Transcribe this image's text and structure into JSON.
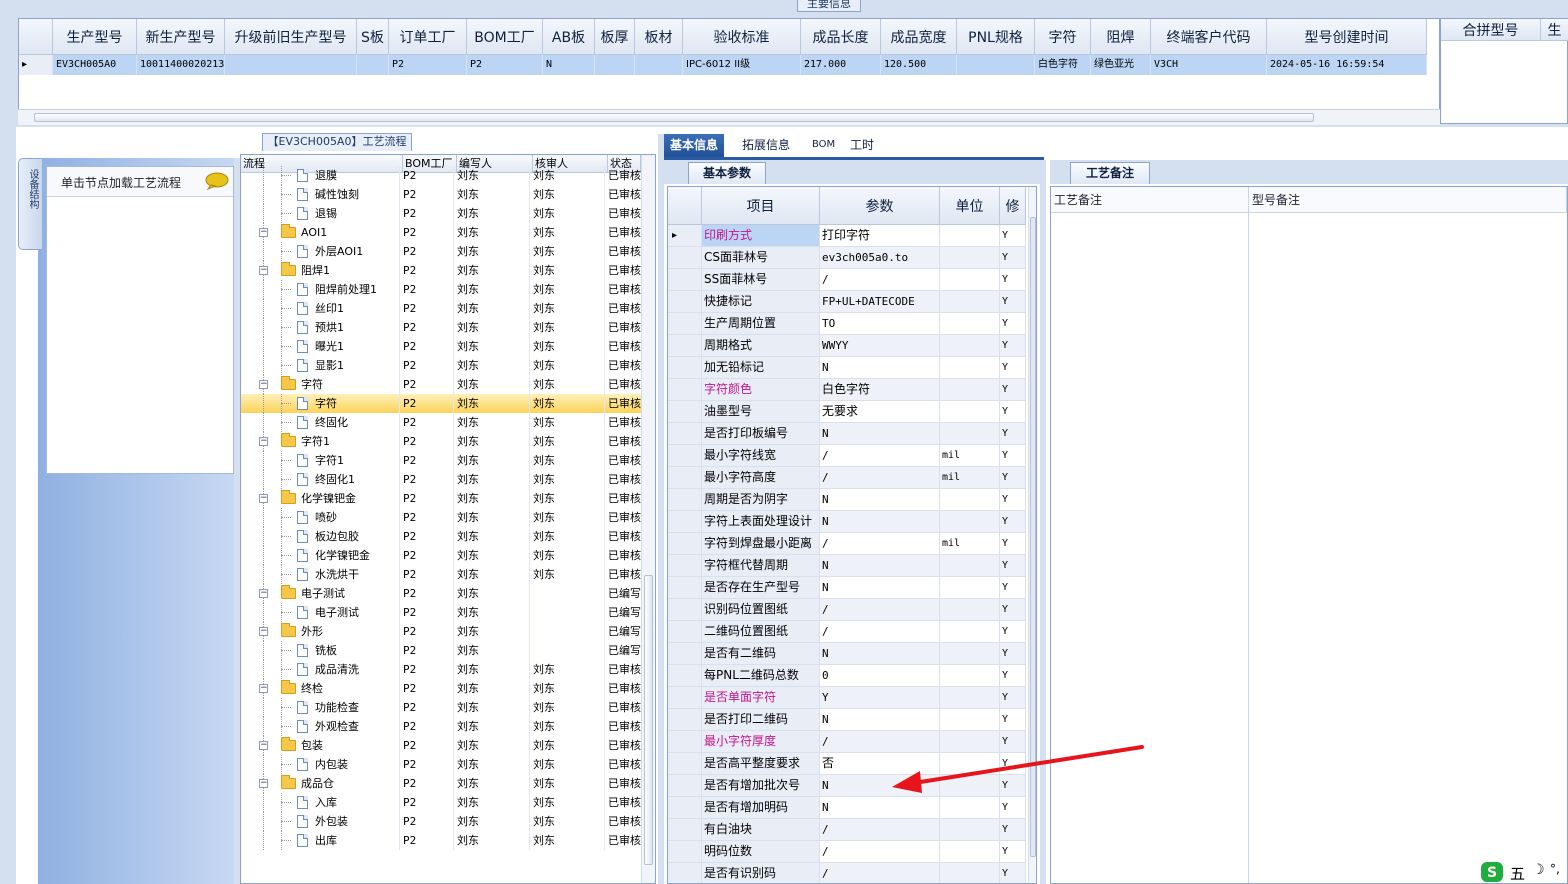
{
  "top": {
    "caption": "主要信息",
    "columns": [
      {
        "label": "生产型号",
        "w": 84
      },
      {
        "label": "新生产型号",
        "w": 88
      },
      {
        "label": "升级前旧生产型号",
        "w": 132
      },
      {
        "label": "S板",
        "w": 32
      },
      {
        "label": "订单工厂",
        "w": 78
      },
      {
        "label": "BOM工厂",
        "w": 76
      },
      {
        "label": "AB板",
        "w": 52
      },
      {
        "label": "板厚",
        "w": 40
      },
      {
        "label": "板材",
        "w": 48
      },
      {
        "label": "验收标准",
        "w": 118
      },
      {
        "label": "成品长度",
        "w": 80
      },
      {
        "label": "成品宽度",
        "w": 76
      },
      {
        "label": "PNL规格",
        "w": 78
      },
      {
        "label": "字符",
        "w": 56
      },
      {
        "label": "阻焊",
        "w": 60
      },
      {
        "label": "终端客户代码",
        "w": 116
      },
      {
        "label": "型号创建时间",
        "w": 160
      }
    ],
    "row": [
      "EV3CH005A0",
      "10011400020213",
      "",
      "",
      "P2",
      "P2",
      "N",
      "",
      "",
      "IPC-6012 II级",
      "217.000",
      "120.500",
      "",
      "白色字符",
      "绿色亚光",
      "V3CH",
      "2024-05-16 16:59:54"
    ],
    "merge_header": "合拼型号",
    "merge_header2": "生"
  },
  "side": {
    "tab_label": "设备结构",
    "hint": "单击节点加载工艺流程"
  },
  "tree": {
    "caption": "【EV3CH005A0】工艺流程",
    "headers": [
      "流程",
      "BOM工厂",
      "编写人",
      "核审人",
      "状态"
    ],
    "rows": [
      {
        "label": "退膜",
        "level": 2,
        "kind": "doc",
        "bom": "P2",
        "writer": "刘东",
        "reviewer": "刘东",
        "status": "已审核",
        "partial": true
      },
      {
        "label": "碱性蚀刻",
        "level": 2,
        "kind": "doc",
        "bom": "P2",
        "writer": "刘东",
        "reviewer": "刘东",
        "status": "已审核"
      },
      {
        "label": "退锡",
        "level": 2,
        "kind": "doc",
        "bom": "P2",
        "writer": "刘东",
        "reviewer": "刘东",
        "status": "已审核"
      },
      {
        "label": "AOI1",
        "level": 1,
        "kind": "folder",
        "bom": "P2",
        "writer": "刘东",
        "reviewer": "刘东",
        "status": "已审核"
      },
      {
        "label": "外层AOI1",
        "level": 2,
        "kind": "doc",
        "bom": "P2",
        "writer": "刘东",
        "reviewer": "刘东",
        "status": "已审核"
      },
      {
        "label": "阻焊1",
        "level": 1,
        "kind": "folder",
        "bom": "P2",
        "writer": "刘东",
        "reviewer": "刘东",
        "status": "已审核"
      },
      {
        "label": "阻焊前处理1",
        "level": 2,
        "kind": "doc",
        "bom": "P2",
        "writer": "刘东",
        "reviewer": "刘东",
        "status": "已审核"
      },
      {
        "label": "丝印1",
        "level": 2,
        "kind": "doc",
        "bom": "P2",
        "writer": "刘东",
        "reviewer": "刘东",
        "status": "已审核"
      },
      {
        "label": "预烘1",
        "level": 2,
        "kind": "doc",
        "bom": "P2",
        "writer": "刘东",
        "reviewer": "刘东",
        "status": "已审核"
      },
      {
        "label": "曝光1",
        "level": 2,
        "kind": "doc",
        "bom": "P2",
        "writer": "刘东",
        "reviewer": "刘东",
        "status": "已审核"
      },
      {
        "label": "显影1",
        "level": 2,
        "kind": "doc",
        "bom": "P2",
        "writer": "刘东",
        "reviewer": "刘东",
        "status": "已审核"
      },
      {
        "label": "字符",
        "level": 1,
        "kind": "folder",
        "bom": "P2",
        "writer": "刘东",
        "reviewer": "刘东",
        "status": "已审核"
      },
      {
        "label": "字符",
        "level": 2,
        "kind": "doc",
        "bom": "P2",
        "writer": "刘东",
        "reviewer": "刘东",
        "status": "已审核",
        "selected": true
      },
      {
        "label": "终固化",
        "level": 2,
        "kind": "doc",
        "bom": "P2",
        "writer": "刘东",
        "reviewer": "刘东",
        "status": "已审核"
      },
      {
        "label": "字符1",
        "level": 1,
        "kind": "folder",
        "bom": "P2",
        "writer": "刘东",
        "reviewer": "刘东",
        "status": "已审核"
      },
      {
        "label": "字符1",
        "level": 2,
        "kind": "doc",
        "bom": "P2",
        "writer": "刘东",
        "reviewer": "刘东",
        "status": "已审核"
      },
      {
        "label": "终固化1",
        "level": 2,
        "kind": "doc",
        "bom": "P2",
        "writer": "刘东",
        "reviewer": "刘东",
        "status": "已审核"
      },
      {
        "label": "化学镍钯金",
        "level": 1,
        "kind": "folder",
        "bom": "P2",
        "writer": "刘东",
        "reviewer": "刘东",
        "status": "已审核"
      },
      {
        "label": "喷砂",
        "level": 2,
        "kind": "doc",
        "bom": "P2",
        "writer": "刘东",
        "reviewer": "刘东",
        "status": "已审核"
      },
      {
        "label": "板边包胶",
        "level": 2,
        "kind": "doc",
        "bom": "P2",
        "writer": "刘东",
        "reviewer": "刘东",
        "status": "已审核"
      },
      {
        "label": "化学镍钯金",
        "level": 2,
        "kind": "doc",
        "bom": "P2",
        "writer": "刘东",
        "reviewer": "刘东",
        "status": "已审核"
      },
      {
        "label": "水洗烘干",
        "level": 2,
        "kind": "doc",
        "bom": "P2",
        "writer": "刘东",
        "reviewer": "刘东",
        "status": "已审核"
      },
      {
        "label": "电子测试",
        "level": 1,
        "kind": "folder",
        "bom": "P2",
        "writer": "刘东",
        "reviewer": "",
        "status": "已编写"
      },
      {
        "label": "电子测试",
        "level": 2,
        "kind": "doc",
        "bom": "P2",
        "writer": "刘东",
        "reviewer": "",
        "status": "已编写"
      },
      {
        "label": "外形",
        "level": 1,
        "kind": "folder",
        "bom": "P2",
        "writer": "刘东",
        "reviewer": "",
        "status": "已编写"
      },
      {
        "label": "铣板",
        "level": 2,
        "kind": "doc",
        "bom": "P2",
        "writer": "刘东",
        "reviewer": "",
        "status": "已编写"
      },
      {
        "label": "成品清洗",
        "level": 2,
        "kind": "doc",
        "bom": "P2",
        "writer": "刘东",
        "reviewer": "刘东",
        "status": "已审核"
      },
      {
        "label": "终检",
        "level": 1,
        "kind": "folder",
        "bom": "P2",
        "writer": "刘东",
        "reviewer": "刘东",
        "status": "已审核"
      },
      {
        "label": "功能检查",
        "level": 2,
        "kind": "doc",
        "bom": "P2",
        "writer": "刘东",
        "reviewer": "刘东",
        "status": "已审核"
      },
      {
        "label": "外观检查",
        "level": 2,
        "kind": "doc",
        "bom": "P2",
        "writer": "刘东",
        "reviewer": "刘东",
        "status": "已审核"
      },
      {
        "label": "包装",
        "level": 1,
        "kind": "folder",
        "bom": "P2",
        "writer": "刘东",
        "reviewer": "刘东",
        "status": "已审核"
      },
      {
        "label": "内包装",
        "level": 2,
        "kind": "doc",
        "bom": "P2",
        "writer": "刘东",
        "reviewer": "刘东",
        "status": "已审核"
      },
      {
        "label": "成品仓",
        "level": 1,
        "kind": "folder",
        "bom": "P2",
        "writer": "刘东",
        "reviewer": "刘东",
        "status": "已审核"
      },
      {
        "label": "入库",
        "level": 2,
        "kind": "doc",
        "bom": "P2",
        "writer": "刘东",
        "reviewer": "刘东",
        "status": "已审核"
      },
      {
        "label": "外包装",
        "level": 2,
        "kind": "doc",
        "bom": "P2",
        "writer": "刘东",
        "reviewer": "刘东",
        "status": "已审核"
      },
      {
        "label": "出库",
        "level": 2,
        "kind": "doc",
        "bom": "P2",
        "writer": "刘东",
        "reviewer": "刘东",
        "status": "已审核"
      }
    ]
  },
  "tabs": [
    "基本信息",
    "拓展信息",
    "BOM",
    "工时"
  ],
  "param": {
    "subtab": "基本参数",
    "headers": [
      "项目",
      "参数",
      "单位",
      "修"
    ],
    "rows": [
      {
        "item": "印刷方式",
        "value": "打印字符",
        "unit": "",
        "mod": "Y",
        "pink": true,
        "sel": true
      },
      {
        "item": "CS面菲林号",
        "value": "ev3ch005a0.to",
        "unit": "",
        "mod": "Y"
      },
      {
        "item": "SS面菲林号",
        "value": "/",
        "unit": "",
        "mod": "Y"
      },
      {
        "item": "快捷标记",
        "value": "FP+UL+DATECODE",
        "unit": "",
        "mod": "Y"
      },
      {
        "item": "生产周期位置",
        "value": "TO",
        "unit": "",
        "mod": "Y"
      },
      {
        "item": "周期格式",
        "value": "WWYY",
        "unit": "",
        "mod": "Y"
      },
      {
        "item": "加无铅标记",
        "value": "N",
        "unit": "",
        "mod": "Y"
      },
      {
        "item": "字符颜色",
        "value": "白色字符",
        "unit": "",
        "mod": "Y",
        "pink": true
      },
      {
        "item": "油墨型号",
        "value": "无要求",
        "unit": "",
        "mod": "Y"
      },
      {
        "item": "是否打印板编号",
        "value": "N",
        "unit": "",
        "mod": "Y"
      },
      {
        "item": "最小字符线宽",
        "value": "/",
        "unit": "mil",
        "mod": "Y"
      },
      {
        "item": "最小字符高度",
        "value": "/",
        "unit": "mil",
        "mod": "Y"
      },
      {
        "item": "周期是否为阴字",
        "value": "N",
        "unit": "",
        "mod": "Y"
      },
      {
        "item": "字符上表面处理设计",
        "value": "N",
        "unit": "",
        "mod": "Y"
      },
      {
        "item": "字符到焊盘最小距离",
        "value": "/",
        "unit": "mil",
        "mod": "Y"
      },
      {
        "item": "字符框代替周期",
        "value": "N",
        "unit": "",
        "mod": "Y"
      },
      {
        "item": "是否存在生产型号",
        "value": "N",
        "unit": "",
        "mod": "Y"
      },
      {
        "item": "识别码位置图纸",
        "value": "/",
        "unit": "",
        "mod": "Y"
      },
      {
        "item": "二维码位置图纸",
        "value": "/",
        "unit": "",
        "mod": "Y"
      },
      {
        "item": "是否有二维码",
        "value": "N",
        "unit": "",
        "mod": "Y"
      },
      {
        "item": "每PNL二维码总数",
        "value": "0",
        "unit": "",
        "mod": "Y"
      },
      {
        "item": "是否单面字符",
        "value": "Y",
        "unit": "",
        "mod": "Y",
        "pink": true
      },
      {
        "item": "是否打印二维码",
        "value": "N",
        "unit": "",
        "mod": "Y"
      },
      {
        "item": "最小字符厚度",
        "value": "/",
        "unit": "",
        "mod": "Y",
        "pink": true
      },
      {
        "item": "是否高平整度要求",
        "value": "否",
        "unit": "",
        "mod": "Y"
      },
      {
        "item": "是否有增加批次号",
        "value": "N",
        "unit": "",
        "mod": "Y"
      },
      {
        "item": "是否有增加明码",
        "value": "N",
        "unit": "",
        "mod": "Y"
      },
      {
        "item": "有白油块",
        "value": "/",
        "unit": "",
        "mod": "Y"
      },
      {
        "item": "明码位数",
        "value": "/",
        "unit": "",
        "mod": "Y"
      },
      {
        "item": "是否有识别码",
        "value": "/",
        "unit": "",
        "mod": "Y"
      }
    ]
  },
  "remarks": {
    "tab": "工艺备注",
    "col1": "工艺备注",
    "col2": "型号备注"
  },
  "tray": {
    "ime": "五"
  },
  "colors": {
    "accent": "#2a5ba3",
    "selection": "#bcd5f5",
    "highlight_row": "#fcd35a",
    "pink_item": "#c0168b",
    "arrow": "#e8141b"
  }
}
